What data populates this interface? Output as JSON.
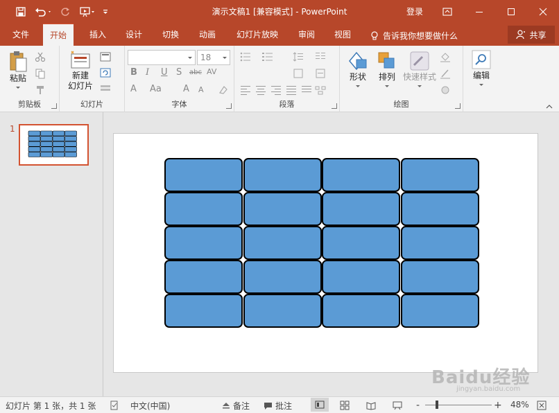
{
  "title_bar": {
    "title": "演示文稿1 [兼容模式] - PowerPoint",
    "login": "登录",
    "colors": {
      "accent": "#b7472a"
    }
  },
  "tabs": [
    {
      "label": "文件",
      "active": false
    },
    {
      "label": "开始",
      "active": true
    },
    {
      "label": "插入",
      "active": false
    },
    {
      "label": "设计",
      "active": false
    },
    {
      "label": "切换",
      "active": false
    },
    {
      "label": "动画",
      "active": false
    },
    {
      "label": "幻灯片放映",
      "active": false
    },
    {
      "label": "审阅",
      "active": false
    },
    {
      "label": "视图",
      "active": false
    }
  ],
  "tell_me": "告诉我你想要做什么",
  "share": "共享",
  "ribbon": {
    "clipboard": {
      "paste_label": "粘贴",
      "group_label": "剪贴板"
    },
    "slides": {
      "new_slide_line1": "新建",
      "new_slide_line2": "幻灯片",
      "group_label": "幻灯片"
    },
    "font": {
      "font_name": "",
      "font_size": "18",
      "group_label": "字体"
    },
    "paragraph": {
      "group_label": "段落"
    },
    "drawing": {
      "shapes_label": "形状",
      "arrange_label": "排列",
      "quick_styles_label": "快速样式",
      "group_label": "绘图"
    },
    "editing": {
      "edit_label": "编辑"
    }
  },
  "thumbnails": [
    {
      "number": "1"
    }
  ],
  "slide": {
    "table_grid": {
      "rows": 5,
      "cols": 4,
      "fill_color": "#5b9bd5",
      "border_color": "#000000"
    }
  },
  "status_bar": {
    "slide_info": "幻灯片 第 1 张，共 1 张",
    "language": "中文(中国)",
    "notes": "备注",
    "comments": "批注",
    "zoom_minus": "-",
    "zoom_plus": "+",
    "zoom_level": "48%"
  },
  "watermark": {
    "text": "Baidu经验",
    "url_text": "jingyan.baidu.com"
  }
}
